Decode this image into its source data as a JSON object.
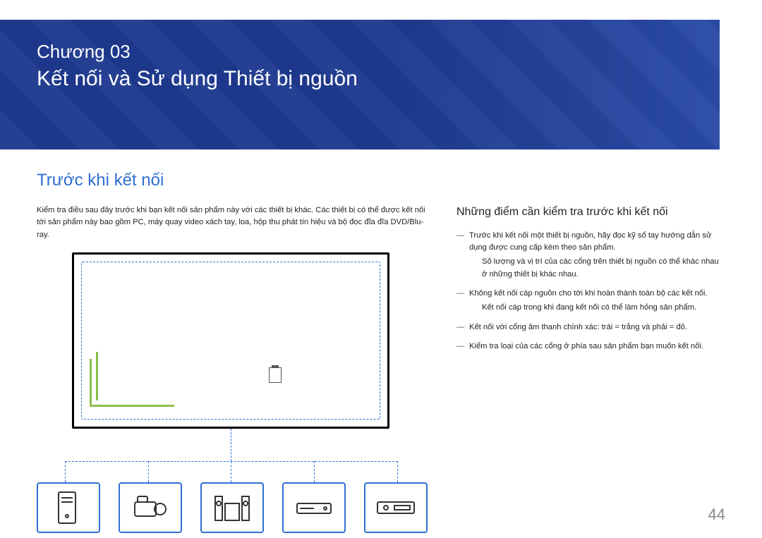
{
  "header": {
    "chapter_label": "Chương 03",
    "chapter_title": "Kết nối và Sử dụng Thiết bị nguồn"
  },
  "section_title": "Trước khi kết nối",
  "intro_text": "Kiểm tra điều sau đây trước khi bạn kết nối sản phẩm này với các thiết bị khác. Các thiết bị có thể được kết nối tới sản phẩm này bao gồm PC, máy quay video xách tay, loa, hộp thu phát tín hiệu và bộ đọc đĩa đĩa DVD/Blu-ray.",
  "sub_heading": "Những điểm cần kiểm tra trước khi kết nối",
  "bullets": [
    {
      "text": "Trước khi kết nối một thiết bị nguồn, hãy đọc kỹ sổ tay hướng dẫn sử dụng được cung cấp kèm theo sản phẩm.",
      "sub": "Số lượng và vị trí của các cổng trên thiết bị nguồn có thể khác nhau ở những thiết bị khác nhau."
    },
    {
      "text": "Không kết nối cáp nguồn cho tới khi hoàn thành toàn bộ các kết nối.",
      "sub": "Kết nối cáp trong khi đang kết nối có thể làm hỏng sản phẩm."
    },
    {
      "text": "Kết nối với cổng âm thanh chính xác: trái = trắng và phải = đỏ."
    },
    {
      "text": "Kiểm tra loại của các cổng ở phía sau sản phẩm bạn muốn kết nối."
    }
  ],
  "devices": [
    {
      "name": "pc-tower"
    },
    {
      "name": "camcorder"
    },
    {
      "name": "speaker-system"
    },
    {
      "name": "set-top-box"
    },
    {
      "name": "disc-player"
    }
  ],
  "page_number": "44"
}
